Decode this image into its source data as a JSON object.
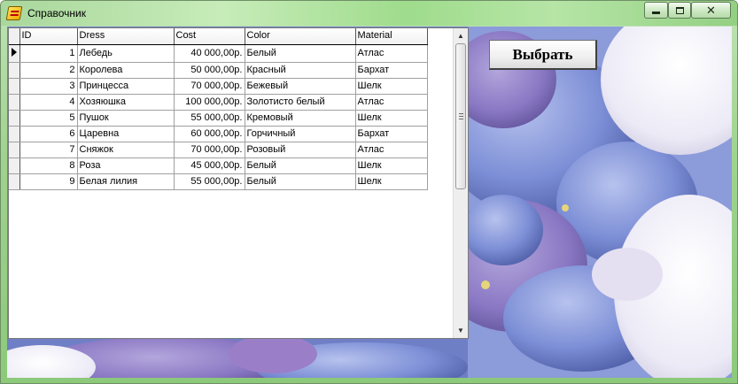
{
  "window": {
    "title": "Справочник",
    "icon": "delphi-app-icon",
    "controls": {
      "minimize": "minimize-icon",
      "maximize": "maximize-icon",
      "close": "close-icon"
    }
  },
  "colors": {
    "titlebar": "#a9d79c",
    "grid_background": "#ffffff",
    "photo_accent": "#7c8fd0"
  },
  "grid": {
    "columns": [
      "ID",
      "Dress",
      "Cost",
      "Color",
      "Material"
    ],
    "selected_row": 0,
    "rows": [
      {
        "id": "1",
        "dress": "Лебедь",
        "cost": "40 000,00р.",
        "color": "Белый",
        "material": "Атлас"
      },
      {
        "id": "2",
        "dress": "Королева",
        "cost": "50 000,00р.",
        "color": "Красный",
        "material": "Бархат"
      },
      {
        "id": "3",
        "dress": "Принцесса",
        "cost": "70 000,00р.",
        "color": "Бежевый",
        "material": "Шелк"
      },
      {
        "id": "4",
        "dress": "Хозяюшка",
        "cost": "100 000,00р.",
        "color": "Золотисто белый",
        "material": "Атлас"
      },
      {
        "id": "5",
        "dress": "Пушок",
        "cost": "55 000,00р.",
        "color": "Кремовый",
        "material": "Шелк"
      },
      {
        "id": "6",
        "dress": "Царевна",
        "cost": "60 000,00р.",
        "color": "Горчичный",
        "material": "Бархат"
      },
      {
        "id": "7",
        "dress": "Сняжок",
        "cost": "70 000,00р.",
        "color": "Розовый",
        "material": "Атлас"
      },
      {
        "id": "8",
        "dress": "Роза",
        "cost": "45 000,00р.",
        "color": "Белый",
        "material": "Шелк"
      },
      {
        "id": "9",
        "dress": "Белая лилия",
        "cost": "55 000,00р.",
        "color": "Белый",
        "material": "Шелк"
      }
    ]
  },
  "select_button": {
    "label": "Выбрать"
  },
  "background": {
    "image": "hydrangea-flowers-photo"
  }
}
